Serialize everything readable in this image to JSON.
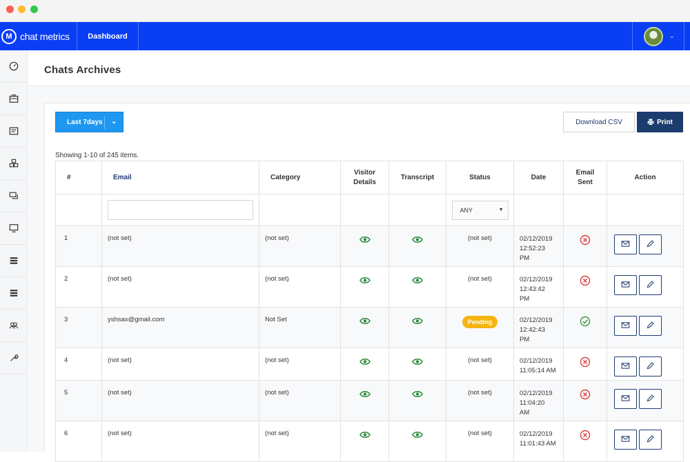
{
  "app": {
    "brand": "chat metrics",
    "brand_logo_letter": "M",
    "nav_dashboard": "Dashboard"
  },
  "sidebar": {
    "items": [
      {
        "icon": "speedometer-icon"
      },
      {
        "icon": "briefcase-icon"
      },
      {
        "icon": "form-icon"
      },
      {
        "icon": "cubes-icon"
      },
      {
        "icon": "chat-bubbles-icon"
      },
      {
        "icon": "monitor-icon"
      },
      {
        "icon": "list-icon"
      },
      {
        "icon": "list-icon"
      },
      {
        "icon": "users-icon"
      },
      {
        "icon": "wrench-icon"
      }
    ]
  },
  "page": {
    "title": "Chats Archives"
  },
  "toolbar": {
    "range_label": "Last 7days",
    "download_csv": "Download CSV",
    "print": "Print"
  },
  "summary": "Showing 1-10 of 245 items.",
  "table": {
    "headers": {
      "num": "#",
      "email": "Email",
      "category": "Category",
      "visitor_line1": "Visitor",
      "visitor_line2": "Details",
      "transcript": "Transcript",
      "status": "Status",
      "date": "Date",
      "email_sent_line1": "Email",
      "email_sent_line2": "Sent",
      "action": "Action"
    },
    "status_filter": "ANY",
    "rows": [
      {
        "num": "1",
        "email": "(not set)",
        "category": "(not set)",
        "status": "(not set)",
        "date1": "02/12/2019",
        "date2": "12:52:23",
        "date3": "PM",
        "sent": false
      },
      {
        "num": "2",
        "email": "(not set)",
        "category": "(not set)",
        "status": "(not set)",
        "date1": "02/12/2019",
        "date2": "12:43:42",
        "date3": "PM",
        "sent": false
      },
      {
        "num": "3",
        "email": "yshsax@gmail.com",
        "category": "Not Set",
        "status": "Pending",
        "date1": "02/12/2019",
        "date2": "12:42:43",
        "date3": "PM",
        "sent": true
      },
      {
        "num": "4",
        "email": "(not set)",
        "category": "(not set)",
        "status": "(not set)",
        "date1": "02/12/2019",
        "date2": "11:05:14 AM",
        "date3": "",
        "sent": false
      },
      {
        "num": "5",
        "email": "(not set)",
        "category": "(not set)",
        "status": "(not set)",
        "date1": "02/12/2019",
        "date2": "11:04:20",
        "date3": "AM",
        "sent": false
      },
      {
        "num": "6",
        "email": "(not set)",
        "category": "(not set)",
        "status": "(not set)",
        "date1": "02/12/2019",
        "date2": "11:01:43 AM",
        "date3": "",
        "sent": false
      }
    ]
  },
  "colors": {
    "topbar": "#0a3ef5",
    "primary_button": "#1e97f0",
    "print_button": "#1d3c6e",
    "pending_badge": "#f6b40e",
    "highlight_row": "#fcf7dc",
    "eye_icon": "#2e8b3a",
    "error_icon": "#e03b3b",
    "success_icon": "#3a9a3a"
  }
}
